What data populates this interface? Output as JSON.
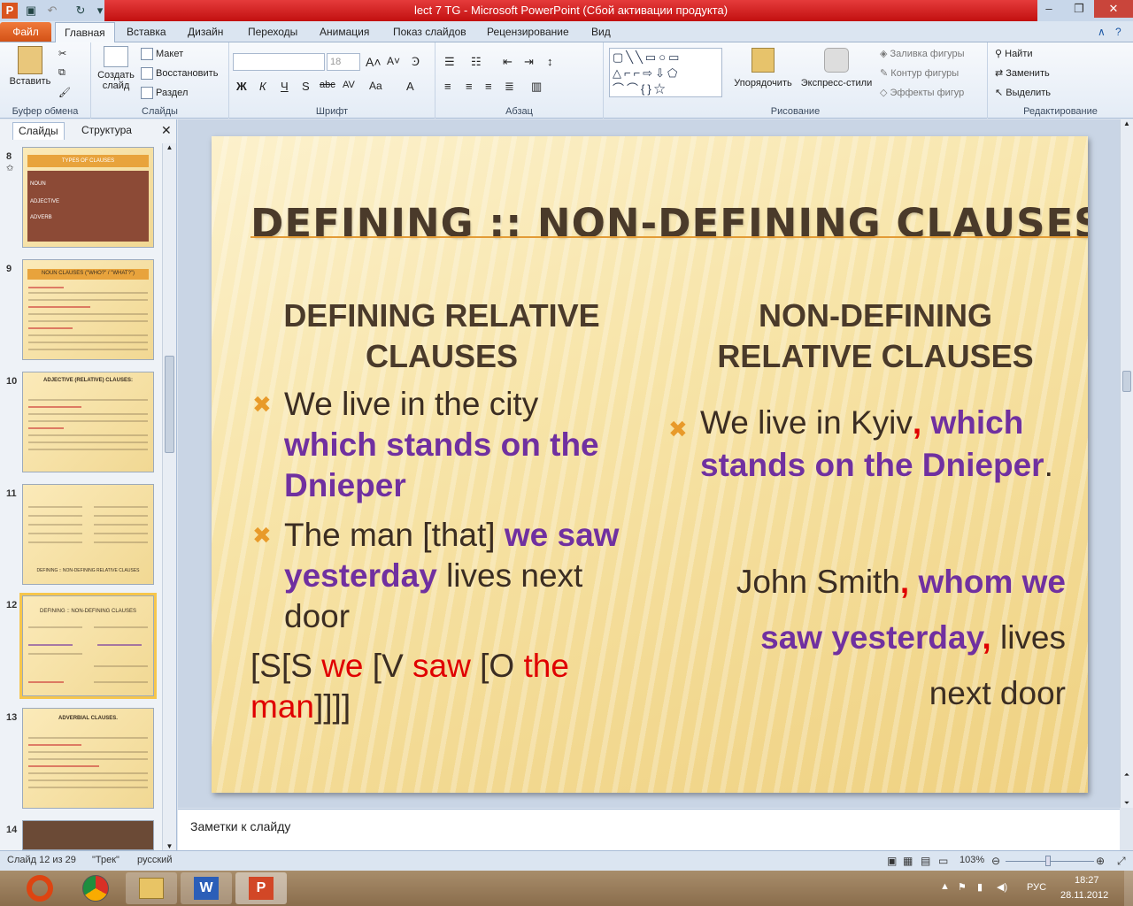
{
  "window": {
    "title": "lect 7 TG  -  Microsoft PowerPoint (Сбой активации продукта)"
  },
  "tabs": [
    "Файл",
    "Главная",
    "Вставка",
    "Дизайн",
    "Переходы",
    "Анимация",
    "Показ слайдов",
    "Рецензирование",
    "Вид"
  ],
  "ribbon": {
    "clipboard": {
      "paste": "Вставить",
      "label": "Буфер обмена"
    },
    "slides": {
      "create": "Создать",
      "create2": "слайд",
      "layout": "Макет",
      "reset": "Восстановить",
      "section": "Раздел",
      "label": "Слайды"
    },
    "font": {
      "size": "18",
      "label": "Шрифт"
    },
    "paragraph": {
      "label": "Абзац"
    },
    "drawing": {
      "arrange": "Упорядочить",
      "styles": "Экспресс-стили",
      "fill": "Заливка фигуры",
      "outline": "Контур фигуры",
      "effects": "Эффекты фигур",
      "label": "Рисование"
    },
    "editing": {
      "find": "Найти",
      "replace": "Заменить",
      "select": "Выделить",
      "label": "Редактирование"
    }
  },
  "panel": {
    "tab_slides": "Слайды",
    "tab_outline": "Структура"
  },
  "thumbs": [
    {
      "num": "8",
      "title": "TYPES OF CLAUSES",
      "items": [
        "NOUN",
        "ADJECTIVE",
        "ADVERB"
      ]
    },
    {
      "num": "9",
      "title": "NOUN CLAUSES (\"WHO?\" / \"WHAT?\")"
    },
    {
      "num": "10",
      "title": "ADJECTIVE (RELATIVE) CLAUSES:"
    },
    {
      "num": "11",
      "title": "DEFINING :: NON-DEFINING RELATIVE CLAUSES"
    },
    {
      "num": "12",
      "title": "DEFINING :: NON-DEFINING CLAUSES"
    },
    {
      "num": "13",
      "title": "ADVERBIAL CLAUSES."
    },
    {
      "num": "14",
      "title": ""
    }
  ],
  "slide": {
    "title": "DEFINING :: NON-DEFINING CLAUSES",
    "left_header": "DEFINING RELATIVE CLAUSES",
    "right_header": "NON-DEFINING RELATIVE CLAUSES",
    "b1_plain": "We live in the city",
    "b1_pur": "which stands on the Dnieper",
    "b2_a": "The man [that]",
    "b2_pur": "we saw yesterday",
    "b2_b": "lives next door",
    "parse": {
      "p1": "[S[S",
      "p2": "we",
      "p3": "[V",
      "p4": "saw",
      "p5": "[O",
      "p6": "the man",
      "p7": "]]]]"
    },
    "r1_plain": "We live in Kyiv",
    "r1_comma": ",",
    "r1_pur": "which stands on the Dnieper",
    "r1_dot": ".",
    "r2_plain": "John Smith",
    "r2_pur": "whom we saw yesterday",
    "r2_end": "lives next door"
  },
  "notes": "Заметки к слайду",
  "status": {
    "slide": "Слайд 12 из 29",
    "theme": "\"Трек\"",
    "lang": "русский",
    "zoom": "103%"
  },
  "tray": {
    "lang": "РУС",
    "time": "18:27",
    "date": "28.11.2012"
  }
}
